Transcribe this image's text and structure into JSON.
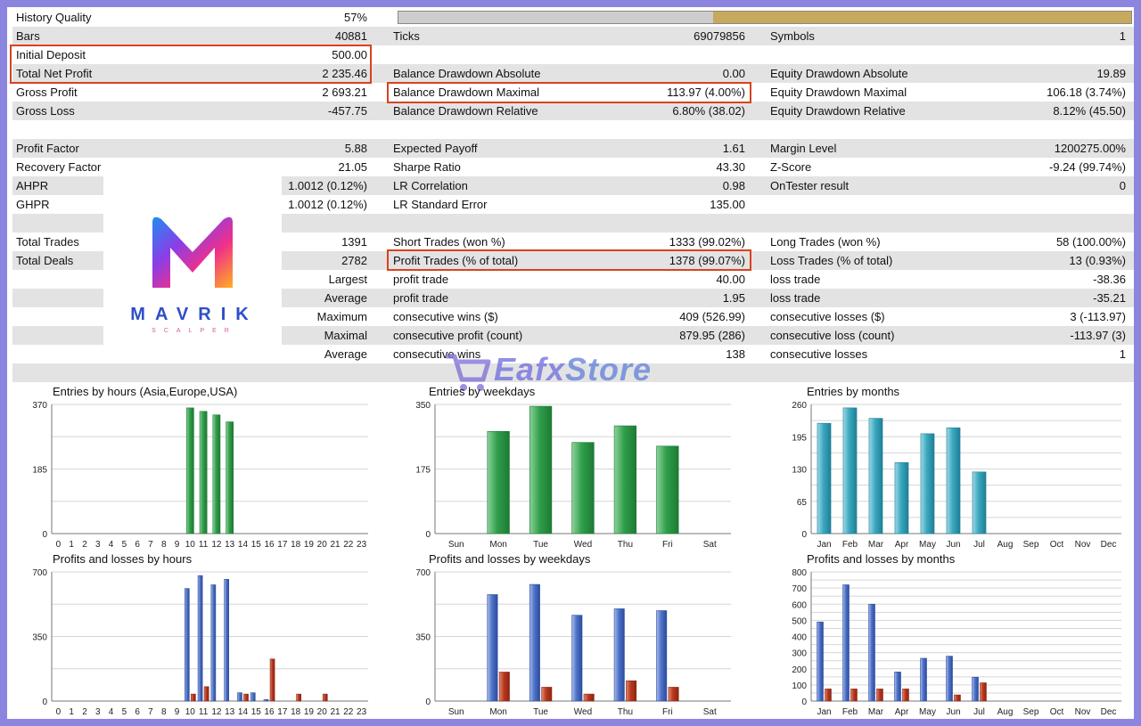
{
  "stats": {
    "history_quality": {
      "label": "History Quality",
      "value": "57%",
      "fraction": 0.57
    },
    "bars": {
      "label": "Bars",
      "value": "40881"
    },
    "ticks": {
      "label": "Ticks",
      "value": "69079856"
    },
    "symbols": {
      "label": "Symbols",
      "value": "1"
    },
    "initial_deposit": {
      "label": "Initial Deposit",
      "value": "500.00"
    },
    "total_net_profit": {
      "label": "Total Net Profit",
      "value": "2 235.46"
    },
    "balance_dd_abs": {
      "label": "Balance Drawdown Absolute",
      "value": "0.00"
    },
    "equity_dd_abs": {
      "label": "Equity Drawdown Absolute",
      "value": "19.89"
    },
    "gross_profit": {
      "label": "Gross Profit",
      "value": "2 693.21"
    },
    "balance_dd_max": {
      "label": "Balance Drawdown Maximal",
      "value": "113.97 (4.00%)"
    },
    "equity_dd_max": {
      "label": "Equity Drawdown Maximal",
      "value": "106.18 (3.74%)"
    },
    "gross_loss": {
      "label": "Gross Loss",
      "value": "-457.75"
    },
    "balance_dd_rel": {
      "label": "Balance Drawdown Relative",
      "value": "6.80% (38.02)"
    },
    "equity_dd_rel": {
      "label": "Equity Drawdown Relative",
      "value": "8.12% (45.50)"
    },
    "profit_factor": {
      "label": "Profit Factor",
      "value": "5.88"
    },
    "expected_payoff": {
      "label": "Expected Payoff",
      "value": "1.61"
    },
    "margin_level": {
      "label": "Margin Level",
      "value": "1200275.00%"
    },
    "recovery_factor": {
      "label": "Recovery Factor",
      "value": "21.05"
    },
    "sharpe_ratio": {
      "label": "Sharpe Ratio",
      "value": "43.30"
    },
    "z_score": {
      "label": "Z-Score",
      "value": "-9.24 (99.74%)"
    },
    "ahpr": {
      "label": "AHPR",
      "value": "1.0012 (0.12%)"
    },
    "lr_correlation": {
      "label": "LR Correlation",
      "value": "0.98"
    },
    "ontester": {
      "label": "OnTester result",
      "value": "0"
    },
    "ghpr": {
      "label": "GHPR",
      "value": "1.0012 (0.12%)"
    },
    "lr_std_error": {
      "label": "LR Standard Error",
      "value": "135.00"
    },
    "total_trades": {
      "label": "Total Trades",
      "value": "1391"
    },
    "short_trades": {
      "label": "Short Trades (won %)",
      "value": "1333 (99.02%)"
    },
    "long_trades": {
      "label": "Long Trades (won %)",
      "value": "58 (100.00%)"
    },
    "total_deals": {
      "label": "Total Deals",
      "value": "2782"
    },
    "profit_trades": {
      "label": "Profit Trades (% of total)",
      "value": "1378 (99.07%)"
    },
    "loss_trades": {
      "label": "Loss Trades (% of total)",
      "value": "13 (0.93%)"
    },
    "largest": {
      "label": "Largest",
      "p_label": "profit trade",
      "p_value": "40.00",
      "l_label": "loss trade",
      "l_value": "-38.36"
    },
    "average": {
      "label": "Average",
      "p_label": "profit trade",
      "p_value": "1.95",
      "l_label": "loss trade",
      "l_value": "-35.21"
    },
    "maximum": {
      "label": "Maximum",
      "p_label": "consecutive wins ($)",
      "p_value": "409 (526.99)",
      "l_label": "consecutive losses ($)",
      "l_value": "3 (-113.97)"
    },
    "maximal": {
      "label": "Maximal",
      "p_label": "consecutive profit (count)",
      "p_value": "879.95 (286)",
      "l_label": "consecutive loss (count)",
      "l_value": "-113.97 (3)"
    },
    "average2": {
      "label": "Average",
      "p_label": "consecutive wins",
      "p_value": "138",
      "l_label": "consecutive losses",
      "l_value": "1"
    }
  },
  "brand": {
    "word": "MAVRIK",
    "sub": "SCALPER",
    "icon": "mavrik-m-logo"
  },
  "watermark": {
    "part1": "Eafx",
    "part2": "Store",
    "icon": "shopping-cart-icon"
  },
  "colors": {
    "highlight": "#d9421e",
    "quality_fill": "#c6a95c",
    "shade": "#e3e3e3"
  },
  "chart_data": [
    {
      "type": "bar",
      "title": "Entries by hours (Asia,Europe,USA)",
      "categories": [
        "0",
        "1",
        "2",
        "3",
        "4",
        "5",
        "6",
        "7",
        "8",
        "9",
        "10",
        "11",
        "12",
        "13",
        "14",
        "15",
        "16",
        "17",
        "18",
        "19",
        "20",
        "21",
        "22",
        "23"
      ],
      "series": [
        {
          "values": [
            0,
            0,
            0,
            0,
            0,
            0,
            0,
            0,
            0,
            0,
            360,
            350,
            340,
            320,
            0,
            0,
            0,
            0,
            0,
            0,
            0,
            0,
            0,
            0
          ],
          "color": "green"
        }
      ],
      "ylim": [
        0,
        370
      ],
      "yticks": [
        "0",
        "185",
        "370"
      ],
      "grid": true
    },
    {
      "type": "bar",
      "title": "Entries by weekdays",
      "categories": [
        "Sun",
        "Mon",
        "Tue",
        "Wed",
        "Thu",
        "Fri",
        "Sat"
      ],
      "series": [
        {
          "values": [
            0,
            277,
            345,
            247,
            292,
            237,
            0
          ],
          "color": "green"
        }
      ],
      "ylim": [
        0,
        350
      ],
      "yticks": [
        "0",
        "175",
        "350"
      ],
      "grid": true
    },
    {
      "type": "bar",
      "title": "Entries by months",
      "categories": [
        "Jan",
        "Feb",
        "Mar",
        "Apr",
        "May",
        "Jun",
        "Jul",
        "Aug",
        "Sep",
        "Oct",
        "Nov",
        "Dec"
      ],
      "series": [
        {
          "values": [
            222,
            253,
            232,
            143,
            201,
            213,
            124,
            0,
            0,
            0,
            0,
            0
          ],
          "color": "teal"
        }
      ],
      "ylim": [
        0,
        260
      ],
      "yticks": [
        "0",
        "65",
        "130",
        "195",
        "260"
      ],
      "grid": true
    },
    {
      "type": "bar",
      "title": "Profits and losses by hours",
      "categories": [
        "0",
        "1",
        "2",
        "3",
        "4",
        "5",
        "6",
        "7",
        "8",
        "9",
        "10",
        "11",
        "12",
        "13",
        "14",
        "15",
        "16",
        "17",
        "18",
        "19",
        "20",
        "21",
        "22",
        "23"
      ],
      "series": [
        {
          "values": [
            0,
            0,
            0,
            0,
            0,
            0,
            0,
            0,
            0,
            0,
            610,
            680,
            630,
            660,
            45,
            45,
            8,
            0,
            0,
            0,
            0,
            0,
            0,
            0
          ],
          "color": "blue"
        },
        {
          "values": [
            0,
            0,
            0,
            0,
            0,
            0,
            0,
            0,
            0,
            0,
            38,
            78,
            0,
            0,
            38,
            0,
            228,
            0,
            38,
            0,
            38,
            0,
            0,
            0
          ],
          "color": "red"
        }
      ],
      "ylim": [
        0,
        700
      ],
      "yticks": [
        "0",
        "350",
        "700"
      ],
      "grid": true
    },
    {
      "type": "bar",
      "title": "Profits and losses by weekdays",
      "categories": [
        "Sun",
        "Mon",
        "Tue",
        "Wed",
        "Thu",
        "Fri",
        "Sat"
      ],
      "series": [
        {
          "values": [
            0,
            577,
            632,
            465,
            500,
            490,
            0
          ],
          "color": "blue"
        },
        {
          "values": [
            0,
            157,
            75,
            38,
            110,
            75,
            0
          ],
          "color": "red"
        }
      ],
      "ylim": [
        0,
        700
      ],
      "yticks": [
        "0",
        "350",
        "700"
      ],
      "grid": true
    },
    {
      "type": "bar",
      "title": "Profits and losses by months",
      "categories": [
        "Jan",
        "Feb",
        "Mar",
        "Apr",
        "May",
        "Jun",
        "Jul",
        "Aug",
        "Sep",
        "Oct",
        "Nov",
        "Dec"
      ],
      "series": [
        {
          "values": [
            490,
            720,
            600,
            180,
            265,
            278,
            148,
            0,
            0,
            0,
            0,
            0
          ],
          "color": "blue"
        },
        {
          "values": [
            75,
            75,
            75,
            75,
            0,
            38,
            113,
            0,
            0,
            0,
            0,
            0
          ],
          "color": "red"
        }
      ],
      "ylim": [
        0,
        800
      ],
      "yticks": [
        "0",
        "100",
        "200",
        "300",
        "400",
        "500",
        "600",
        "700",
        "800"
      ],
      "grid": true
    }
  ]
}
